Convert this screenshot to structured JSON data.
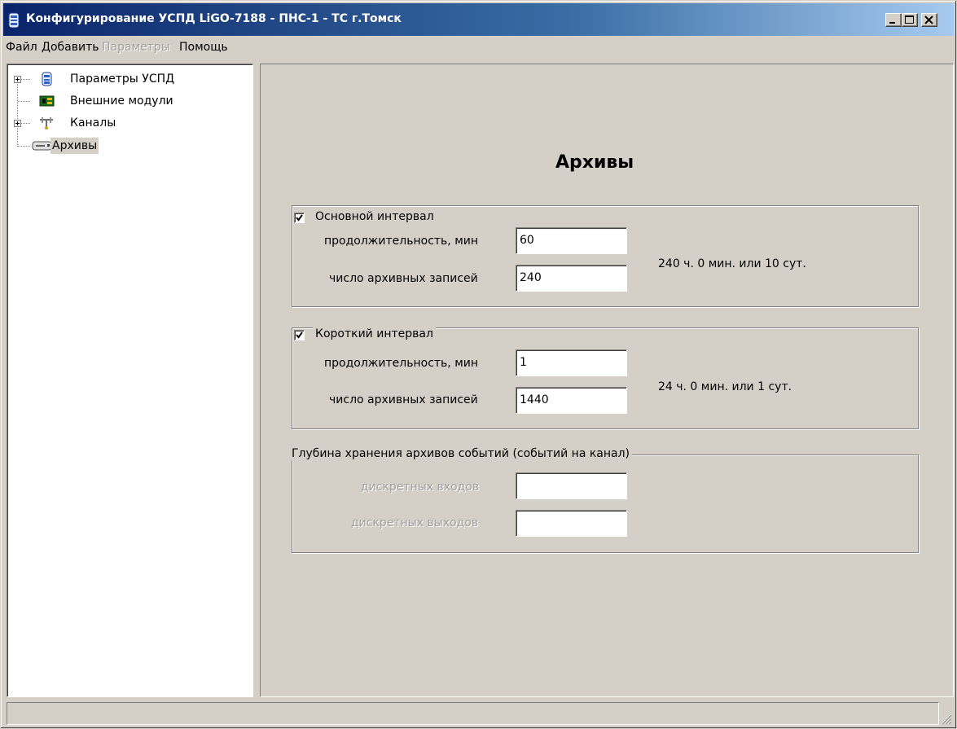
{
  "window": {
    "title": "Конфигурирование УСПД LiGO-7188 - ПНС-1 - ТС г.Томск",
    "controls": {
      "minimize": "minimize",
      "maximize": "maximize",
      "close": "close"
    }
  },
  "menu": [
    {
      "label": "Файл",
      "enabled": true
    },
    {
      "label": "Добавить",
      "enabled": true
    },
    {
      "label": "Параметры",
      "enabled": false
    },
    {
      "label": "Помощь",
      "enabled": true
    }
  ],
  "tree": [
    {
      "label": "Параметры УСПД",
      "icon": "device-icon",
      "expandable": true,
      "selected": false
    },
    {
      "label": "Внешние модули",
      "icon": "module-board-icon",
      "expandable": false,
      "selected": false
    },
    {
      "label": "Каналы",
      "icon": "channels-icon",
      "expandable": true,
      "selected": false
    },
    {
      "label": "Архивы",
      "icon": "archive-drive-icon",
      "expandable": false,
      "selected": true
    }
  ],
  "page": {
    "heading": "Архивы"
  },
  "main_interval": {
    "legend": "Основной интервал",
    "checked": true,
    "duration_label": "продолжительность, мин",
    "duration_value": "60",
    "records_label": "число архивных записей",
    "records_value": "240",
    "summary": "240 ч. 0 мин. или 10 сут."
  },
  "short_interval": {
    "legend": "Короткий интервал",
    "checked": true,
    "duration_label": "продолжительность, мин",
    "duration_value": "1",
    "records_label": "число архивных записей",
    "records_value": "1440",
    "summary": "24 ч. 0 мин. или 1 сут."
  },
  "events_depth": {
    "legend": "Глубина хранения архивов событий (событий на канал)",
    "inputs_label": "дискретных входов",
    "inputs_value": "",
    "outputs_label": "дискретных выходов",
    "outputs_value": ""
  },
  "colors": {
    "titlebar_start": "#0a246a",
    "titlebar_end": "#a6caf0",
    "face": "#d4d0c8",
    "disabled_text": "#a0a0a0"
  }
}
